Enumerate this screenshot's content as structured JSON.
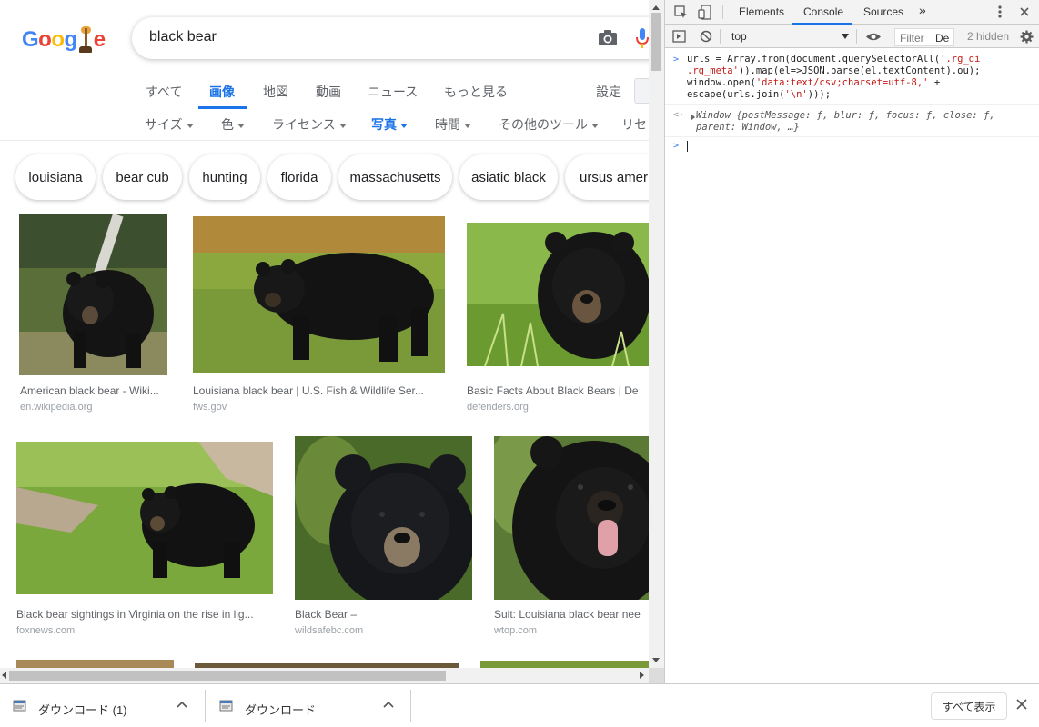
{
  "search": {
    "query": "black bear"
  },
  "logo": {
    "text_parts": [
      "G",
      "o",
      "o",
      "g",
      "l",
      "e"
    ],
    "colors": [
      "#4285f4",
      "#ea4335",
      "#fbbc05",
      "#4285f4",
      "#34a853",
      "#ea4335"
    ]
  },
  "tabs": [
    {
      "label": "すべて",
      "active": false
    },
    {
      "label": "画像",
      "active": true
    },
    {
      "label": "地図",
      "active": false
    },
    {
      "label": "動画",
      "active": false
    },
    {
      "label": "ニュース",
      "active": false
    },
    {
      "label": "もっと見る",
      "active": false
    }
  ],
  "settings_label": "設定",
  "tools": [
    {
      "label": "サイズ",
      "active": false
    },
    {
      "label": "色",
      "active": false
    },
    {
      "label": "ライセンス",
      "active": false
    },
    {
      "label": "写真",
      "active": true
    },
    {
      "label": "時間",
      "active": false
    },
    {
      "label": "その他のツール",
      "active": false
    },
    {
      "label": "リセット",
      "active": false
    }
  ],
  "chips": [
    "louisiana",
    "bear cub",
    "hunting",
    "florida",
    "massachusetts",
    "asiatic black",
    "ursus americanus"
  ],
  "results": [
    {
      "title": "American black bear - Wiki...",
      "domain": "en.wikipedia.org",
      "scene": "forest"
    },
    {
      "title": "Louisiana black bear | U.S. Fish & Wildlife Ser...",
      "domain": "fws.gov",
      "scene": "lawn"
    },
    {
      "title": "Basic Facts About Black Bears | De",
      "domain": "defenders.org",
      "scene": "grass-face"
    },
    {
      "title": "Black bear sightings in Virginia on the rise in lig...",
      "domain": "foxnews.com",
      "scene": "meadow"
    },
    {
      "title": "Black Bear –",
      "domain": "wildsafebc.com",
      "scene": "portrait"
    },
    {
      "title": "Suit: Louisiana black bear nee",
      "domain": "wtop.com",
      "scene": "tongue"
    }
  ],
  "devtools": {
    "tabs": [
      {
        "label": "Elements",
        "active": false
      },
      {
        "label": "Console",
        "active": true
      },
      {
        "label": "Sources",
        "active": false
      }
    ],
    "more_tabs": "»",
    "context": "top",
    "filter_placeholder": "Filter",
    "level_label": "De",
    "hidden_count": "2 hidden",
    "console_input": [
      [
        "urls = Array.from(document.querySelectorAll(",
        "'.rg_di",
        ""
      ],
      [
        "",
        ".rg_meta'",
        ")).map(el=>JSON.parse(el.textContent).ou);"
      ],
      [
        "window.open(",
        "'data:text/csv;charset=utf-8,'",
        " +"
      ],
      [
        "escape(urls.join(",
        "'\\n'",
        ")));"
      ]
    ],
    "console_result": [
      "Window {postMessage: ƒ, blur: ƒ, focus: ƒ, close: ƒ,",
      "parent: Window, …}"
    ]
  },
  "downloads": {
    "items": [
      "ダウンロード (1)",
      "ダウンロード"
    ],
    "show_all": "すべて表示"
  }
}
